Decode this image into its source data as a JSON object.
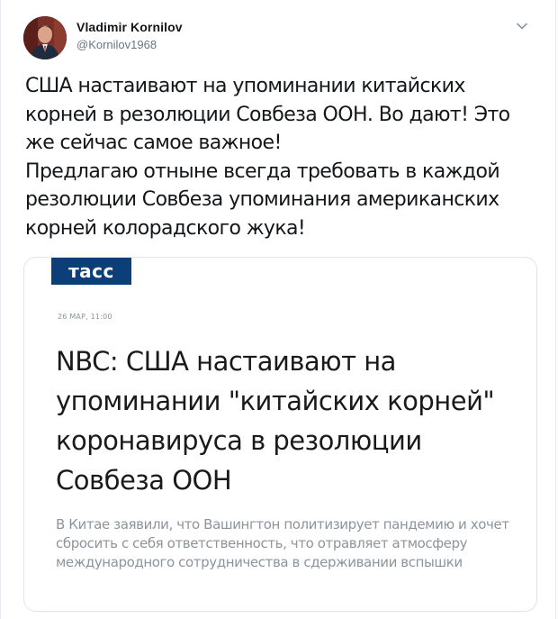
{
  "author": {
    "name": "Vladimir Kornilov",
    "handle": "@Kornilov1968"
  },
  "tweet": {
    "paragraph_1": "США настаивают на упоминании китайских корней в резолюции Совбеза ООН. Во дают! Это же сейчас самое важное!",
    "paragraph_2": "Предлагаю отныне всегда требовать в каждой резолюции Совбеза упоминания американских корней колорадского жука!"
  },
  "card": {
    "logo_text": "тасс",
    "date": "26 МАР, 11:00",
    "headline": "NBC: США настаивают на упоминании \"китайских корней\" коронавируса в резолюции Совбеза ООН",
    "lead": "В Китае заявили, что Вашингтон политизирует пандемию и хочет сбросить с себя ответственность, что отравляет атмосферу международного сотрудничества в сдерживании вспышки"
  },
  "colors": {
    "tass_blue": "#0c3e77",
    "text_primary": "#14171a",
    "text_secondary": "#657786"
  },
  "icons": {
    "menu": "chevron-down-icon"
  }
}
